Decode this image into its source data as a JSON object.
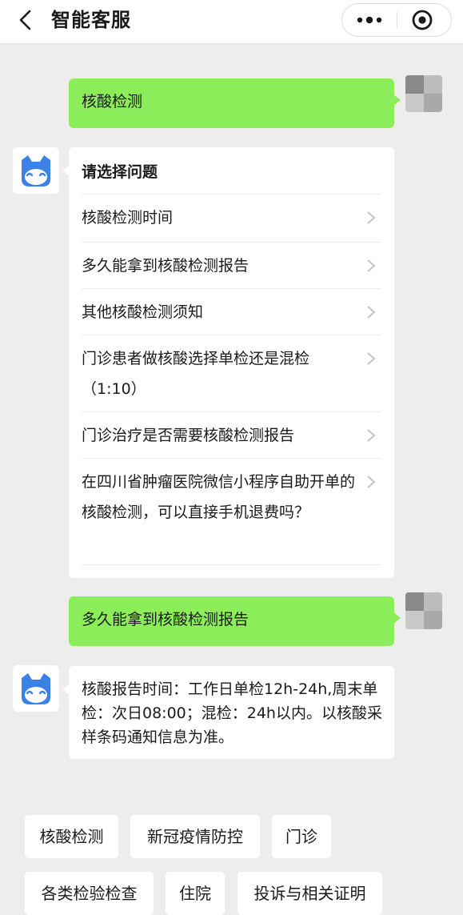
{
  "header": {
    "title": "智能客服",
    "icons": [
      "chevron-left-icon",
      "more-dots-icon",
      "target-close-icon"
    ]
  },
  "messages": {
    "user_1": "核酸检测",
    "menu": {
      "title": "请选择问题",
      "items": [
        {
          "label": "核酸检测时间"
        },
        {
          "label": "多久能拿到核酸检测报告"
        },
        {
          "label": "其他核酸检测须知"
        },
        {
          "label": "门诊患者做核酸选择单检还是混检（1:10）"
        },
        {
          "label": "门诊治疗是否需要核酸检测报告"
        },
        {
          "label": "在四川省肿瘤医院微信小程序自助开单的核酸检测，可以直接手机退费吗？"
        }
      ]
    },
    "user_2": "多久能拿到核酸检测报告",
    "bot_answer": "核酸报告时间：工作日单检12h-24h,周末单检：次日08:00；混检：24h以内。以核酸采样条码通知信息为准。"
  },
  "quick_replies": [
    "核酸检测",
    "新冠疫情防控",
    "门诊",
    "各类检验检查",
    "住院",
    "投诉与相关证明"
  ],
  "colors": {
    "user_bubble": "#8ced5a",
    "bot_bubble": "#ffffff",
    "background": "#ededed",
    "bot_icon_blue": "#3b82e8"
  }
}
